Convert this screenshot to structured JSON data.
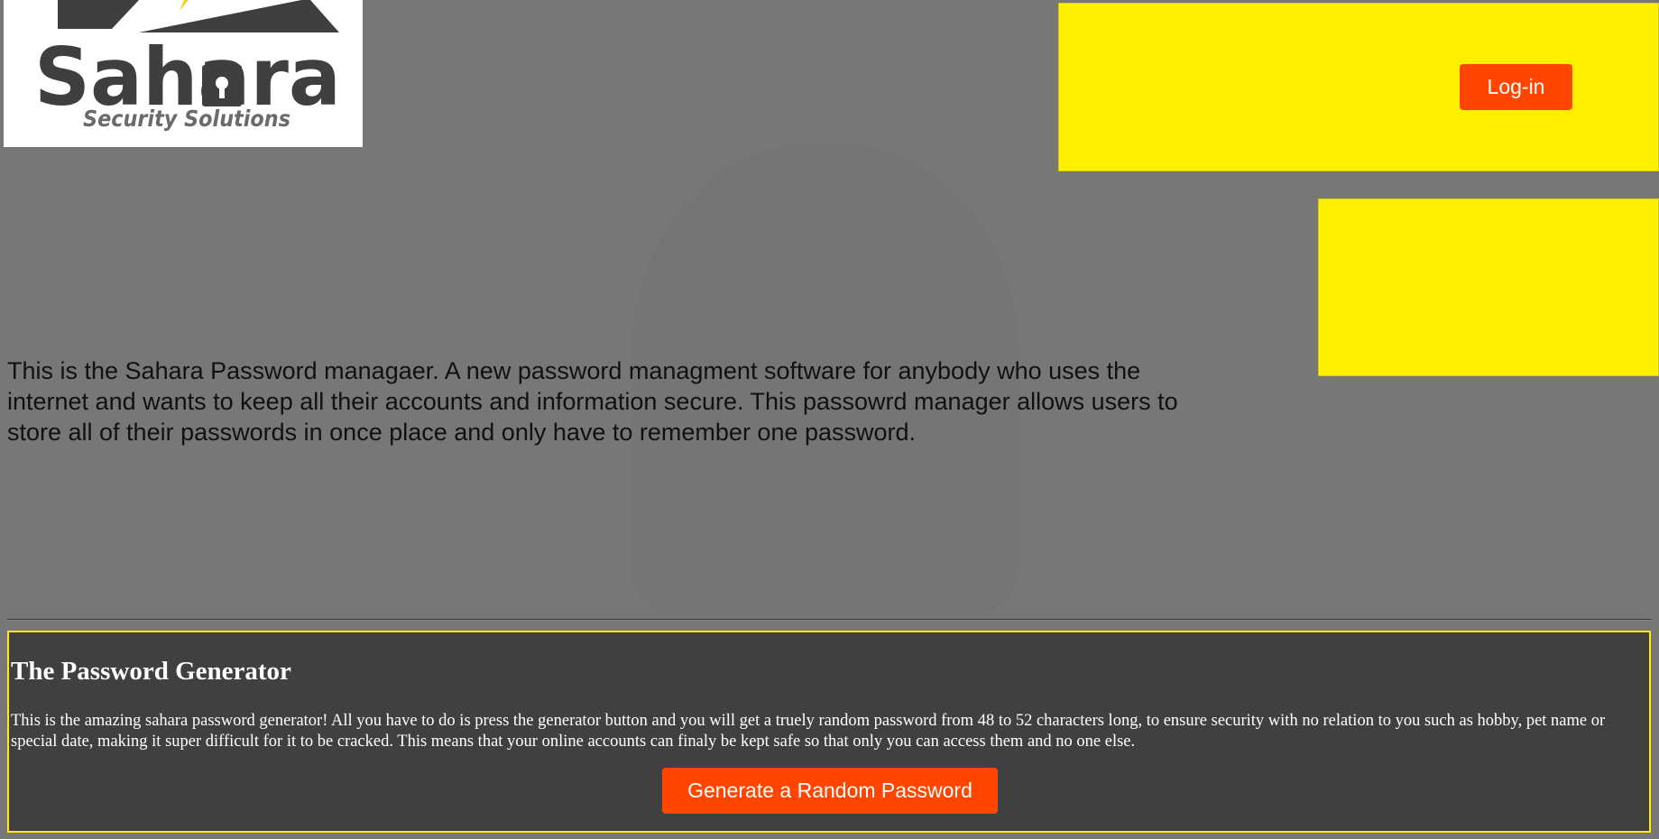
{
  "header": {
    "logo_wordmark": "Sahara",
    "logo_tagline": "Security Solutions",
    "login_label": "Log-in"
  },
  "intro": {
    "text": "This is the Sahara Password managaer. A new password managment software for anybody who uses the internet and wants to keep all their accounts and information secure. This passowrd manager allows users to store all of their passwords in once place and only have to remember one password."
  },
  "generator": {
    "title": "The Password Generator",
    "description": "This is the amazing sahara password generator! All you have to do is press the generator button and you will get a truely random password from 48 to 52 characters long, to ensure security with no relation to you such as hobby, pet name or special date, making it super difficult for it to be cracked. This means that your online accounts can finaly be kept safe so that only you can access them and no one else.",
    "button_label": "Generate a Random Password"
  },
  "colors": {
    "page_background": "#777777",
    "accent_yellow": "#fff000",
    "button_orange": "#ff4500",
    "panel_dark": "#404040"
  }
}
